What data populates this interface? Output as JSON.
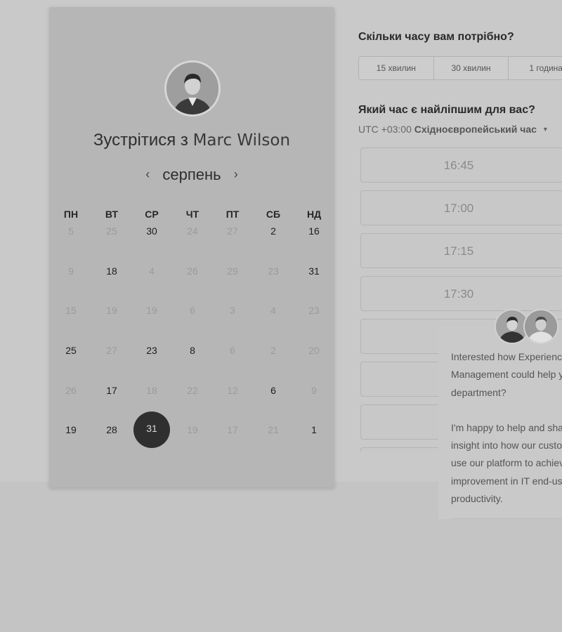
{
  "calendar": {
    "title_prefix": "Зустрітися з",
    "host_name": "Marc Wilson",
    "month": "серпень",
    "prev_arrow": "‹",
    "next_arrow": "›",
    "weekdays": [
      "ПН",
      "ВТ",
      "СР",
      "ЧТ",
      "ПТ",
      "СБ",
      "НД"
    ],
    "weeks": [
      [
        {
          "d": "5",
          "s": "muted"
        },
        {
          "d": "25",
          "s": "muted"
        },
        {
          "d": "30",
          "s": "active"
        },
        {
          "d": "24",
          "s": "muted"
        },
        {
          "d": "27",
          "s": "muted"
        },
        {
          "d": "2",
          "s": "active"
        },
        {
          "d": "16",
          "s": "active"
        }
      ],
      [
        {
          "d": "9",
          "s": "muted"
        },
        {
          "d": "18",
          "s": "active"
        },
        {
          "d": "4",
          "s": "muted"
        },
        {
          "d": "26",
          "s": "muted"
        },
        {
          "d": "29",
          "s": "muted"
        },
        {
          "d": "23",
          "s": "muted"
        },
        {
          "d": "31",
          "s": "active"
        }
      ],
      [
        {
          "d": "15",
          "s": "muted"
        },
        {
          "d": "19",
          "s": "muted"
        },
        {
          "d": "19",
          "s": "muted"
        },
        {
          "d": "6",
          "s": "muted"
        },
        {
          "d": "3",
          "s": "muted"
        },
        {
          "d": "4",
          "s": "muted"
        },
        {
          "d": "23",
          "s": "muted"
        }
      ],
      [
        {
          "d": "25",
          "s": "active"
        },
        {
          "d": "27",
          "s": "muted"
        },
        {
          "d": "23",
          "s": "active"
        },
        {
          "d": "8",
          "s": "active"
        },
        {
          "d": "6",
          "s": "muted"
        },
        {
          "d": "2",
          "s": "muted"
        },
        {
          "d": "20",
          "s": "muted"
        }
      ],
      [
        {
          "d": "26",
          "s": "muted"
        },
        {
          "d": "17",
          "s": "active"
        },
        {
          "d": "18",
          "s": "muted"
        },
        {
          "d": "22",
          "s": "muted"
        },
        {
          "d": "12",
          "s": "muted"
        },
        {
          "d": "6",
          "s": "active"
        },
        {
          "d": "9",
          "s": "muted"
        }
      ],
      [
        {
          "d": "19",
          "s": "active"
        },
        {
          "d": "28",
          "s": "active"
        },
        {
          "d": "31",
          "s": "selected"
        },
        {
          "d": "19",
          "s": "muted"
        },
        {
          "d": "17",
          "s": "muted"
        },
        {
          "d": "21",
          "s": "muted"
        },
        {
          "d": "1",
          "s": "active"
        }
      ]
    ]
  },
  "duration": {
    "question": "Скільки часу вам потрібно?",
    "options": [
      "15 хвилин",
      "30 хвилин",
      "1 година"
    ]
  },
  "time": {
    "question": "Який час є найліпшим для вас?",
    "tz_offset": "UTC +03:00",
    "tz_name": "Східноєвропейський час",
    "slots": [
      "16:45",
      "17:00",
      "17:15",
      "17:30",
      "",
      "",
      "",
      ""
    ]
  },
  "chat": {
    "lines": [
      "Interested how Experience",
      "Management could help your",
      "department?",
      "",
      "I'm happy to help and share",
      "insight into how our customers",
      "use our platform to achieve",
      "improvement in IT end-user",
      "productivity."
    ]
  },
  "colors": {
    "selected_day_bg": "#2f2f2f",
    "card_bg": "#b6b6b6",
    "page_bg": "#c9c9c9"
  }
}
